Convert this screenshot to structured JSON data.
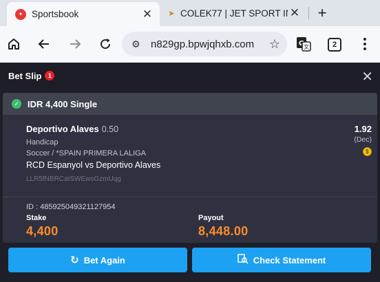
{
  "browser": {
    "tabs": [
      {
        "title": "Sportsbook",
        "favicon": "sportsbook-logo"
      },
      {
        "title": "COLEK77 | JET SPORT INDO",
        "favicon": "jet-logo"
      }
    ],
    "url": "n829gp.bpwjqhxb.com",
    "tab_count": "2"
  },
  "slip": {
    "title": "Bet Slip",
    "count": "1",
    "summary": "IDR 4,400 Single",
    "selection": {
      "team": "Deportivo Alaves",
      "line": "0.50",
      "market": "Handicap",
      "league": "Soccer / *SPAIN PRIMERA LALIGA",
      "match": "RCD Espanyol vs Deportivo Alaves",
      "ref": "LLR5fNBRCaISWEwsGzmUqg",
      "odds": "1.92",
      "odds_type": "(Dec)"
    },
    "bet_id": "ID : 485925049321127954",
    "stake_label": "Stake",
    "stake": "4,400",
    "payout_label": "Payout",
    "payout": "8,448.00"
  },
  "buttons": {
    "bet_again": "Bet Again",
    "check_statement": "Check Statement"
  },
  "colors": {
    "accent": "#1da1f2",
    "amount": "#ff8c2a",
    "success": "#3cc06b",
    "badge": "#e5202b"
  }
}
